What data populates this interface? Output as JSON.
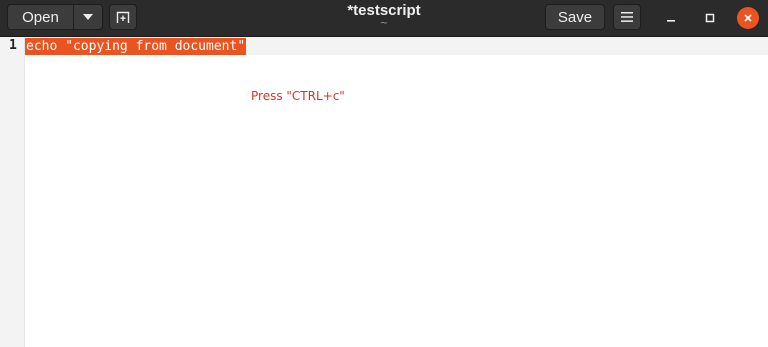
{
  "header": {
    "open_label": "Open",
    "title": "*testscript",
    "subtitle": "~",
    "save_label": "Save"
  },
  "icons": {
    "open_dropdown": "chevron-down-icon",
    "new_tab": "new-tab-icon",
    "menu": "hamburger-menu-icon",
    "minimize": "minimize-icon",
    "maximize": "maximize-icon",
    "close": "close-icon"
  },
  "colors": {
    "selection": "#e95420",
    "close_button": "#e95420",
    "annotation": "#e0302a"
  },
  "editor": {
    "line_number": "1",
    "line_text": "echo \"copying from document\""
  },
  "annotation": {
    "text": "Press \"CTRL+c\""
  }
}
